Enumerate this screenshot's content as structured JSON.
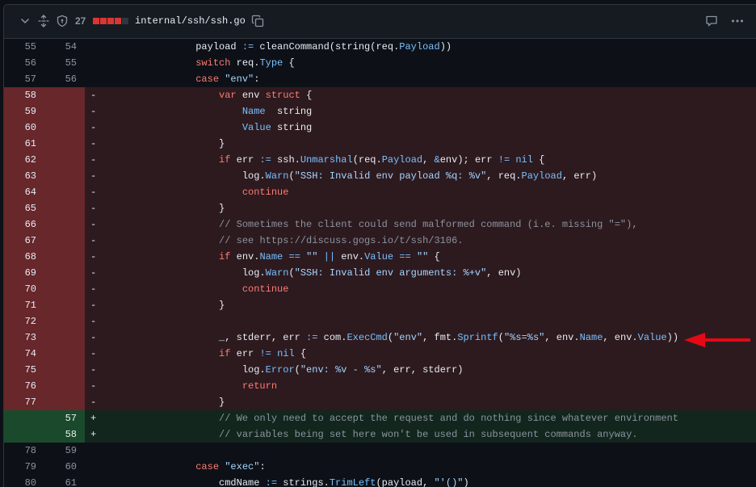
{
  "file": {
    "changes": "27",
    "path": "internal/ssh/ssh.go",
    "diffstat": [
      "#da3633",
      "#da3633",
      "#da3633",
      "#da3633",
      "#30363d"
    ]
  },
  "icons": {
    "collapse": "chevron-down-icon",
    "expand": "unfold-icon",
    "shield": "shield-icon",
    "copy": "copy-icon",
    "comment": "comment-icon",
    "more": "kebab-horizontal-icon",
    "arrow": "red-arrow-icon"
  },
  "lines": [
    {
      "type": "ctx",
      "o": "55",
      "n": "54",
      "sign": "",
      "t": [
        [
          "",
          "                payload "
        ],
        [
          "f",
          ":="
        ],
        [
          "",
          " cleanCommand(string(req."
        ],
        [
          "f",
          "Payload"
        ],
        [
          "",
          "))"
        ]
      ]
    },
    {
      "type": "ctx",
      "o": "56",
      "n": "55",
      "sign": "",
      "t": [
        [
          "",
          "                "
        ],
        [
          "k",
          "switch"
        ],
        [
          "",
          " req."
        ],
        [
          "f",
          "Type"
        ],
        [
          "",
          " {"
        ]
      ]
    },
    {
      "type": "ctx",
      "o": "57",
      "n": "56",
      "sign": "",
      "t": [
        [
          "",
          "                "
        ],
        [
          "k",
          "case"
        ],
        [
          "",
          " "
        ],
        [
          "s",
          "\"env\""
        ],
        [
          "",
          ":"
        ]
      ]
    },
    {
      "type": "del",
      "o": "58",
      "n": "",
      "sign": "-",
      "t": [
        [
          "",
          "                    "
        ],
        [
          "k",
          "var"
        ],
        [
          "",
          " env "
        ],
        [
          "k",
          "struct"
        ],
        [
          "",
          " {"
        ]
      ]
    },
    {
      "type": "del",
      "o": "59",
      "n": "",
      "sign": "-",
      "t": [
        [
          "",
          "                        "
        ],
        [
          "f",
          "Name"
        ],
        [
          "",
          "  string"
        ]
      ]
    },
    {
      "type": "del",
      "o": "60",
      "n": "",
      "sign": "-",
      "t": [
        [
          "",
          "                        "
        ],
        [
          "f",
          "Value"
        ],
        [
          "",
          " string"
        ]
      ]
    },
    {
      "type": "del",
      "o": "61",
      "n": "",
      "sign": "-",
      "t": [
        [
          "",
          "                    }"
        ]
      ]
    },
    {
      "type": "del",
      "o": "62",
      "n": "",
      "sign": "-",
      "t": [
        [
          "",
          "                    "
        ],
        [
          "k",
          "if"
        ],
        [
          "",
          " err "
        ],
        [
          "f",
          ":="
        ],
        [
          "",
          " ssh."
        ],
        [
          "f",
          "Unmarshal"
        ],
        [
          "",
          "(req."
        ],
        [
          "f",
          "Payload"
        ],
        [
          "",
          ", "
        ],
        [
          "f",
          "&"
        ],
        [
          "",
          "env); err "
        ],
        [
          "f",
          "!="
        ],
        [
          "",
          " "
        ],
        [
          "f",
          "nil"
        ],
        [
          "",
          " {"
        ]
      ]
    },
    {
      "type": "del",
      "o": "63",
      "n": "",
      "sign": "-",
      "t": [
        [
          "",
          "                        log."
        ],
        [
          "f",
          "Warn"
        ],
        [
          "",
          "("
        ],
        [
          "s",
          "\"SSH: Invalid env payload %q: %v\""
        ],
        [
          "",
          ", req."
        ],
        [
          "f",
          "Payload"
        ],
        [
          "",
          ", err)"
        ]
      ]
    },
    {
      "type": "del",
      "o": "64",
      "n": "",
      "sign": "-",
      "t": [
        [
          "",
          "                        "
        ],
        [
          "k",
          "continue"
        ]
      ]
    },
    {
      "type": "del",
      "o": "65",
      "n": "",
      "sign": "-",
      "t": [
        [
          "",
          "                    }"
        ]
      ]
    },
    {
      "type": "del",
      "o": "66",
      "n": "",
      "sign": "-",
      "t": [
        [
          "",
          "                    "
        ],
        [
          "c",
          "// Sometimes the client could send malformed command (i.e. missing \"=\"),"
        ]
      ]
    },
    {
      "type": "del",
      "o": "67",
      "n": "",
      "sign": "-",
      "t": [
        [
          "",
          "                    "
        ],
        [
          "c",
          "// see https://discuss.gogs.io/t/ssh/3106."
        ]
      ]
    },
    {
      "type": "del",
      "o": "68",
      "n": "",
      "sign": "-",
      "t": [
        [
          "",
          "                    "
        ],
        [
          "k",
          "if"
        ],
        [
          "",
          " env."
        ],
        [
          "f",
          "Name"
        ],
        [
          "",
          " "
        ],
        [
          "f",
          "=="
        ],
        [
          "",
          " "
        ],
        [
          "s",
          "\"\""
        ],
        [
          "",
          " "
        ],
        [
          "f",
          "||"
        ],
        [
          "",
          " env."
        ],
        [
          "f",
          "Value"
        ],
        [
          "",
          " "
        ],
        [
          "f",
          "=="
        ],
        [
          "",
          " "
        ],
        [
          "s",
          "\"\""
        ],
        [
          "",
          " {"
        ]
      ]
    },
    {
      "type": "del",
      "o": "69",
      "n": "",
      "sign": "-",
      "t": [
        [
          "",
          "                        log."
        ],
        [
          "f",
          "Warn"
        ],
        [
          "",
          "("
        ],
        [
          "s",
          "\"SSH: Invalid env arguments: %+v\""
        ],
        [
          "",
          ", env)"
        ]
      ]
    },
    {
      "type": "del",
      "o": "70",
      "n": "",
      "sign": "-",
      "t": [
        [
          "",
          "                        "
        ],
        [
          "k",
          "continue"
        ]
      ]
    },
    {
      "type": "del",
      "o": "71",
      "n": "",
      "sign": "-",
      "t": [
        [
          "",
          "                    }"
        ]
      ]
    },
    {
      "type": "del",
      "o": "72",
      "n": "",
      "sign": "-",
      "t": [
        [
          "",
          ""
        ]
      ]
    },
    {
      "type": "del",
      "o": "73",
      "n": "",
      "sign": "-",
      "t": [
        [
          "",
          "                    _, stderr, err "
        ],
        [
          "f",
          ":="
        ],
        [
          "",
          " com."
        ],
        [
          "f",
          "ExecCmd"
        ],
        [
          "",
          "("
        ],
        [
          "s",
          "\"env\""
        ],
        [
          "",
          ", fmt."
        ],
        [
          "f",
          "Sprintf"
        ],
        [
          "",
          "("
        ],
        [
          "s",
          "\"%s=%s\""
        ],
        [
          "",
          ", env."
        ],
        [
          "f",
          "Name"
        ],
        [
          "",
          ", env."
        ],
        [
          "f",
          "Value"
        ],
        [
          "",
          "))"
        ]
      ]
    },
    {
      "type": "del",
      "o": "74",
      "n": "",
      "sign": "-",
      "t": [
        [
          "",
          "                    "
        ],
        [
          "k",
          "if"
        ],
        [
          "",
          " err "
        ],
        [
          "f",
          "!="
        ],
        [
          "",
          " "
        ],
        [
          "f",
          "nil"
        ],
        [
          "",
          " {"
        ]
      ]
    },
    {
      "type": "del",
      "o": "75",
      "n": "",
      "sign": "-",
      "t": [
        [
          "",
          "                        log."
        ],
        [
          "f",
          "Error"
        ],
        [
          "",
          "("
        ],
        [
          "s",
          "\"env: %v - %s\""
        ],
        [
          "",
          ", err, stderr)"
        ]
      ]
    },
    {
      "type": "del",
      "o": "76",
      "n": "",
      "sign": "-",
      "t": [
        [
          "",
          "                        "
        ],
        [
          "k",
          "return"
        ]
      ]
    },
    {
      "type": "del",
      "o": "77",
      "n": "",
      "sign": "-",
      "t": [
        [
          "",
          "                    }"
        ]
      ]
    },
    {
      "type": "add",
      "o": "",
      "n": "57",
      "sign": "+",
      "t": [
        [
          "",
          "                    "
        ],
        [
          "c",
          "// We only need to accept the request and do nothing since whatever environment"
        ]
      ]
    },
    {
      "type": "add",
      "o": "",
      "n": "58",
      "sign": "+",
      "t": [
        [
          "",
          "                    "
        ],
        [
          "c",
          "// variables being set here won't be used in subsequent commands anyway."
        ]
      ]
    },
    {
      "type": "ctx",
      "o": "78",
      "n": "59",
      "sign": "",
      "t": [
        [
          "",
          ""
        ]
      ]
    },
    {
      "type": "ctx",
      "o": "79",
      "n": "60",
      "sign": "",
      "t": [
        [
          "",
          "                "
        ],
        [
          "k",
          "case"
        ],
        [
          "",
          " "
        ],
        [
          "s",
          "\"exec\""
        ],
        [
          "",
          ":"
        ]
      ]
    },
    {
      "type": "ctx",
      "o": "80",
      "n": "61",
      "sign": "",
      "t": [
        [
          "",
          "                    cmdName "
        ],
        [
          "f",
          ":="
        ],
        [
          "",
          " strings."
        ],
        [
          "f",
          "TrimLeft"
        ],
        [
          "",
          "(payload, "
        ],
        [
          "s",
          "\"'()\""
        ],
        [
          "",
          ")"
        ]
      ]
    }
  ]
}
